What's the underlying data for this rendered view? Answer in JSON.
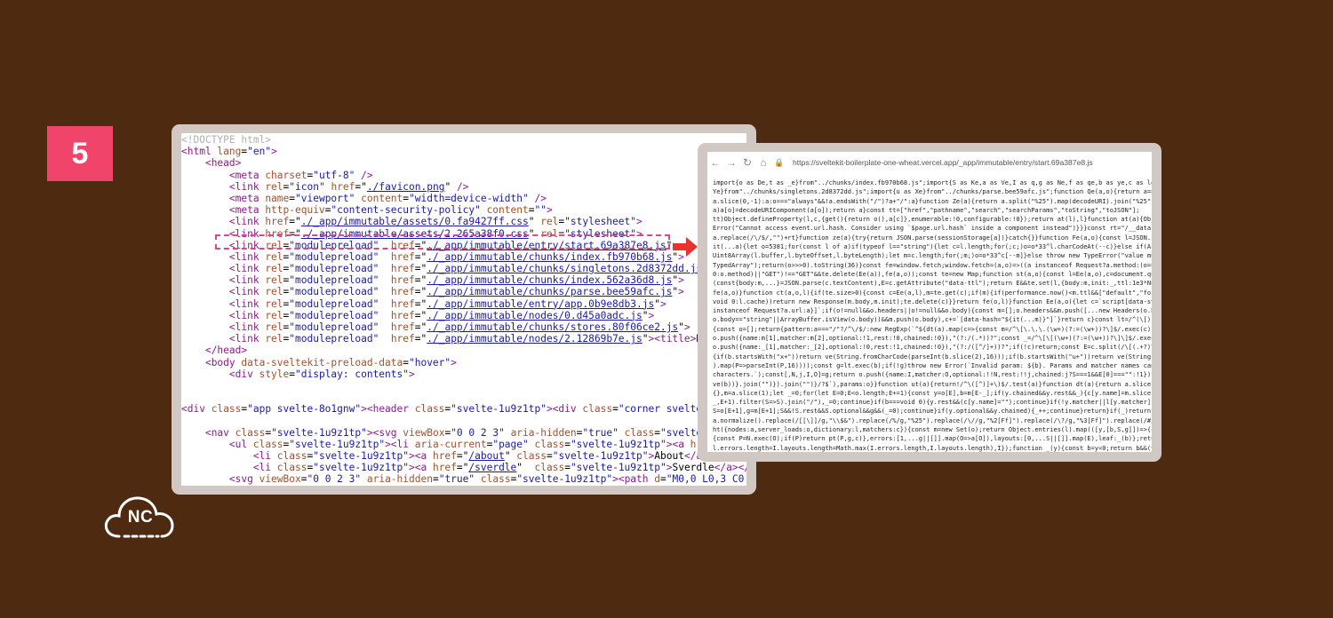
{
  "badge": "5",
  "logo_text": "NC",
  "source_lines": [
    [
      [
        "cm",
        "<!DOCTYPE html>"
      ]
    ],
    [
      [
        "tg",
        "<html "
      ],
      [
        "at",
        "lang"
      ],
      [
        "tx",
        "="
      ],
      [
        "av",
        "\"en\""
      ],
      [
        "tg",
        ">"
      ]
    ],
    [
      [
        "tx",
        "    "
      ],
      [
        "tg",
        "<head>"
      ]
    ],
    [
      [
        "tx",
        "        "
      ],
      [
        "tg",
        "<meta "
      ],
      [
        "at",
        "charset"
      ],
      [
        "tx",
        "="
      ],
      [
        "av",
        "\"utf-8\""
      ],
      [
        "tg",
        " />"
      ]
    ],
    [
      [
        "tx",
        "        "
      ],
      [
        "tg",
        "<link "
      ],
      [
        "at",
        "rel"
      ],
      [
        "tx",
        "="
      ],
      [
        "av",
        "\"icon\""
      ],
      [
        "tx",
        " "
      ],
      [
        "at",
        "href"
      ],
      [
        "tx",
        "=\""
      ],
      [
        "lk",
        "./favicon.png"
      ],
      [
        "tx",
        "\""
      ],
      [
        "tg",
        " />"
      ]
    ],
    [
      [
        "tx",
        "        "
      ],
      [
        "tg",
        "<meta "
      ],
      [
        "at",
        "name"
      ],
      [
        "tx",
        "="
      ],
      [
        "av",
        "\"viewport\""
      ],
      [
        "tx",
        " "
      ],
      [
        "at",
        "content"
      ],
      [
        "tx",
        "="
      ],
      [
        "av",
        "\"width=device-width\""
      ],
      [
        "tg",
        " />"
      ]
    ],
    [
      [
        "tx",
        "        "
      ],
      [
        "tg",
        "<meta "
      ],
      [
        "at",
        "http-equiv"
      ],
      [
        "tx",
        "="
      ],
      [
        "av",
        "\"content-security-policy\""
      ],
      [
        "tx",
        " "
      ],
      [
        "at",
        "content"
      ],
      [
        "tx",
        "="
      ],
      [
        "av",
        "\"\""
      ],
      [
        "tg",
        ">"
      ]
    ],
    [
      [
        "tx",
        "        "
      ],
      [
        "tg",
        "<link "
      ],
      [
        "at",
        "href"
      ],
      [
        "tx",
        "=\""
      ],
      [
        "lk",
        "./_app/immutable/assets/0.fa9427ff.css"
      ],
      [
        "tx",
        "\" "
      ],
      [
        "at",
        "rel"
      ],
      [
        "tx",
        "="
      ],
      [
        "av",
        "\"stylesheet\""
      ],
      [
        "tg",
        ">"
      ]
    ],
    [
      [
        "tx",
        "        "
      ],
      [
        "tg",
        "<link "
      ],
      [
        "at",
        "href"
      ],
      [
        "tx",
        "=\""
      ],
      [
        "lk",
        "./_app/immutable/assets/2.265a38f0.css"
      ],
      [
        "tx",
        "\" "
      ],
      [
        "at",
        "rel"
      ],
      [
        "tx",
        "="
      ],
      [
        "av",
        "\"stylesheet\""
      ],
      [
        "tg",
        ">"
      ]
    ],
    [
      [
        "tx",
        "        "
      ],
      [
        "tg",
        "<link "
      ],
      [
        "at",
        "rel"
      ],
      [
        "tx",
        "="
      ],
      [
        "av",
        "\"modulepreload\""
      ],
      [
        "tx",
        "  "
      ],
      [
        "at",
        "href"
      ],
      [
        "tx",
        "=\""
      ],
      [
        "lk",
        "./_app/immutable/entry/start.69a387e8.js"
      ],
      [
        "tx",
        "\""
      ],
      [
        "tg",
        ">"
      ]
    ],
    [
      [
        "tx",
        "        "
      ],
      [
        "tg",
        "<link "
      ],
      [
        "at",
        "rel"
      ],
      [
        "tx",
        "="
      ],
      [
        "av",
        "\"modulepreload\""
      ],
      [
        "tx",
        "  "
      ],
      [
        "at",
        "href"
      ],
      [
        "tx",
        "=\""
      ],
      [
        "lk",
        "./_app/immutable/chunks/index.fb970b68.js"
      ],
      [
        "tx",
        "\""
      ],
      [
        "tg",
        ">"
      ]
    ],
    [
      [
        "tx",
        "        "
      ],
      [
        "tg",
        "<link "
      ],
      [
        "at",
        "rel"
      ],
      [
        "tx",
        "="
      ],
      [
        "av",
        "\"modulepreload\""
      ],
      [
        "tx",
        "  "
      ],
      [
        "at",
        "href"
      ],
      [
        "tx",
        "=\""
      ],
      [
        "lk",
        "./_app/immutable/chunks/singletons.2d8372dd.js"
      ],
      [
        "tx",
        "\""
      ],
      [
        "tg",
        ">"
      ]
    ],
    [
      [
        "tx",
        "        "
      ],
      [
        "tg",
        "<link "
      ],
      [
        "at",
        "rel"
      ],
      [
        "tx",
        "="
      ],
      [
        "av",
        "\"modulepreload\""
      ],
      [
        "tx",
        "  "
      ],
      [
        "at",
        "href"
      ],
      [
        "tx",
        "=\""
      ],
      [
        "lk",
        "./_app/immutable/chunks/index.562a36d8.js"
      ],
      [
        "tx",
        "\""
      ],
      [
        "tg",
        ">"
      ]
    ],
    [
      [
        "tx",
        "        "
      ],
      [
        "tg",
        "<link "
      ],
      [
        "at",
        "rel"
      ],
      [
        "tx",
        "="
      ],
      [
        "av",
        "\"modulepreload\""
      ],
      [
        "tx",
        "  "
      ],
      [
        "at",
        "href"
      ],
      [
        "tx",
        "=\""
      ],
      [
        "lk",
        "./_app/immutable/chunks/parse.bee59afc.js"
      ],
      [
        "tx",
        "\""
      ],
      [
        "tg",
        ">"
      ]
    ],
    [
      [
        "tx",
        "        "
      ],
      [
        "tg",
        "<link "
      ],
      [
        "at",
        "rel"
      ],
      [
        "tx",
        "="
      ],
      [
        "av",
        "\"modulepreload\""
      ],
      [
        "tx",
        "  "
      ],
      [
        "at",
        "href"
      ],
      [
        "tx",
        "=\""
      ],
      [
        "lk",
        "./_app/immutable/entry/app.0b9e8db3.js"
      ],
      [
        "tx",
        "\""
      ],
      [
        "tg",
        ">"
      ]
    ],
    [
      [
        "tx",
        "        "
      ],
      [
        "tg",
        "<link "
      ],
      [
        "at",
        "rel"
      ],
      [
        "tx",
        "="
      ],
      [
        "av",
        "\"modulepreload\""
      ],
      [
        "tx",
        "  "
      ],
      [
        "at",
        "href"
      ],
      [
        "tx",
        "=\""
      ],
      [
        "lk",
        "./_app/immutable/nodes/0.d45a0adc.js"
      ],
      [
        "tx",
        "\""
      ],
      [
        "tg",
        ">"
      ]
    ],
    [
      [
        "tx",
        "        "
      ],
      [
        "tg",
        "<link "
      ],
      [
        "at",
        "rel"
      ],
      [
        "tx",
        "="
      ],
      [
        "av",
        "\"modulepreload\""
      ],
      [
        "tx",
        "  "
      ],
      [
        "at",
        "href"
      ],
      [
        "tx",
        "=\""
      ],
      [
        "lk",
        "./_app/immutable/chunks/stores.80f06ce2.js"
      ],
      [
        "tx",
        "\""
      ],
      [
        "tg",
        ">"
      ]
    ],
    [
      [
        "tx",
        "        "
      ],
      [
        "tg",
        "<link "
      ],
      [
        "at",
        "rel"
      ],
      [
        "tx",
        "="
      ],
      [
        "av",
        "\"modulepreload\""
      ],
      [
        "tx",
        "  "
      ],
      [
        "at",
        "href"
      ],
      [
        "tx",
        "=\""
      ],
      [
        "lk",
        "./_app/immutable/nodes/2.12869b7e.js"
      ],
      [
        "tx",
        "\""
      ],
      [
        "tg",
        "><title>"
      ],
      [
        "tx",
        "Home"
      ],
      [
        "tg",
        "</tit"
      ]
    ],
    [
      [
        "tx",
        "    "
      ],
      [
        "tg",
        "</head>"
      ]
    ],
    [
      [
        "tx",
        "    "
      ],
      [
        "tg",
        "<body "
      ],
      [
        "at",
        "data-sveltekit-preload-data"
      ],
      [
        "tx",
        "="
      ],
      [
        "av",
        "\"hover\""
      ],
      [
        "tg",
        ">"
      ]
    ],
    [
      [
        "tx",
        "        "
      ],
      [
        "tg",
        "<div "
      ],
      [
        "at",
        "style"
      ],
      [
        "tx",
        "="
      ],
      [
        "av",
        "\"display: contents\""
      ],
      [
        "tg",
        ">"
      ]
    ],
    [
      [
        "tx",
        ""
      ]
    ],
    [
      [
        "tx",
        ""
      ]
    ],
    [
      [
        "tg",
        "<div "
      ],
      [
        "at",
        "class"
      ],
      [
        "tx",
        "="
      ],
      [
        "av",
        "\"app svelte-8o1gnw\""
      ],
      [
        "tg",
        "><header "
      ],
      [
        "at",
        "class"
      ],
      [
        "tx",
        "="
      ],
      [
        "av",
        "\"svelte-1u9z1tp\""
      ],
      [
        "tg",
        "><div "
      ],
      [
        "at",
        "class"
      ],
      [
        "tx",
        "="
      ],
      [
        "av",
        "\"corner svelte-1u9z1"
      ]
    ],
    [
      [
        "tx",
        ""
      ]
    ],
    [
      [
        "tx",
        "    "
      ],
      [
        "tg",
        "<nav "
      ],
      [
        "at",
        "class"
      ],
      [
        "tx",
        "="
      ],
      [
        "av",
        "\"svelte-1u9z1tp\""
      ],
      [
        "tg",
        "><svg "
      ],
      [
        "at",
        "viewBox"
      ],
      [
        "tx",
        "="
      ],
      [
        "av",
        "\"0 0 2 3\""
      ],
      [
        "tx",
        " "
      ],
      [
        "at",
        "aria-hidden"
      ],
      [
        "tx",
        "="
      ],
      [
        "av",
        "\"true\""
      ],
      [
        "tx",
        " "
      ],
      [
        "at",
        "class"
      ],
      [
        "tx",
        "="
      ],
      [
        "av",
        "\"svelte-1u9z1t"
      ]
    ],
    [
      [
        "tx",
        "        "
      ],
      [
        "tg",
        "<ul "
      ],
      [
        "at",
        "class"
      ],
      [
        "tx",
        "="
      ],
      [
        "av",
        "\"svelte-1u9z1tp\""
      ],
      [
        "tg",
        "><li "
      ],
      [
        "at",
        "aria-current"
      ],
      [
        "tx",
        "="
      ],
      [
        "av",
        "\"page\""
      ],
      [
        "tx",
        " "
      ],
      [
        "at",
        "class"
      ],
      [
        "tx",
        "="
      ],
      [
        "av",
        "\"svelte-1u9z1tp\""
      ],
      [
        "tg",
        "><a "
      ],
      [
        "at",
        "href"
      ],
      [
        "tx",
        "=\""
      ],
      [
        "lk",
        "/"
      ]
    ],
    [
      [
        "tx",
        "            "
      ],
      [
        "tg",
        "<li "
      ],
      [
        "at",
        "class"
      ],
      [
        "tx",
        "="
      ],
      [
        "av",
        "\"svelte-1u9z1tp\""
      ],
      [
        "tg",
        "><a "
      ],
      [
        "at",
        "href"
      ],
      [
        "tx",
        "=\""
      ],
      [
        "lk",
        "/about"
      ],
      [
        "tx",
        "\" "
      ],
      [
        "at",
        "class"
      ],
      [
        "tx",
        "="
      ],
      [
        "av",
        "\"svelte-1u9z1tp\""
      ],
      [
        "tg",
        ">"
      ],
      [
        "tx",
        "About"
      ],
      [
        "tg",
        "</a></li"
      ]
    ],
    [
      [
        "tx",
        "            "
      ],
      [
        "tg",
        "<li "
      ],
      [
        "at",
        "class"
      ],
      [
        "tx",
        "="
      ],
      [
        "av",
        "\"svelte-1u9z1tp\""
      ],
      [
        "tg",
        "><a "
      ],
      [
        "at",
        "href"
      ],
      [
        "tx",
        "=\""
      ],
      [
        "lk",
        "/sverdle"
      ],
      [
        "tx",
        "\"  "
      ],
      [
        "at",
        "class"
      ],
      [
        "tx",
        "="
      ],
      [
        "av",
        "\"svelte-1u9z1tp\""
      ],
      [
        "tg",
        ">"
      ],
      [
        "tx",
        "Sverdle"
      ],
      [
        "tg",
        "</a></li></u"
      ]
    ],
    [
      [
        "tx",
        "        "
      ],
      [
        "tg",
        "<svg "
      ],
      [
        "at",
        "viewBox"
      ],
      [
        "tx",
        "="
      ],
      [
        "av",
        "\"0 0 2 3\""
      ],
      [
        "tx",
        " "
      ],
      [
        "at",
        "aria-hidden"
      ],
      [
        "tx",
        "="
      ],
      [
        "av",
        "\"true\""
      ],
      [
        "tx",
        " "
      ],
      [
        "at",
        "class"
      ],
      [
        "tx",
        "="
      ],
      [
        "av",
        "\"svelte-1u9z1tp\""
      ],
      [
        "tg",
        "><path "
      ],
      [
        "at",
        "d"
      ],
      [
        "tx",
        "="
      ],
      [
        "av",
        "\"M0,0 L0,3 C0.5,3 0"
      ]
    ]
  ],
  "browser": {
    "url": "https://sveltekit-boilerplate-one-wheat.vercel.app/_app/immutable/entry/start.69a387e8.js"
  },
  "js_dump": [
    "import{o as De,t as _e}from\"../chunks/index.fb970b68.js\";import{S as Ke,a as Ve,I as q,g as Ne,f as qe,b as ye,c as le,i",
    "Ye}from\"../chunks/singletons.2d8372dd.js\";import{u as Xe}from\"../chunks/parse.bee59afc.js\";function Qe(a,o){return a===",
    "a.slice(0,-1):a:o===\"always\"&&!a.endsWith(\"/\")?a+\"/\":a}function Ze(a){return a.split(\"%25\").map(decodeURI).join(\"%25\")}",
    "a)a[o]=decodeURIComponent(a[o]);return a}const tt=[\"href\",\"pathname\",\"search\",\"searchParams\",\"toString\",\"toJSON\"];",
    "tt)Object.defineProperty(l,c,{get(){return o(),a[c]},enumerable:!0,configurable:!0});return at(l),l}function at(a){Obje",
    "Error(\"Cannot access event.url.hash. Consider using `$page.url.hash` inside a component instead\")}}}const rt=\"/__data.",
    "a.replace(/\\/$/,\"\")+rt}function ze(a){try{return JSON.parse(sessionStorage[a])}catch{}}function Fe(a,o){const l=JSON.st",
    "it(...a){let o=5381;for(const l of a)if(typeof l==\"string\"){let c=l.length;for(;c;)o=o*33^l.charCodeAt(--c)}else if(Arr",
    "Uint8Array(l.buffer,l.byteOffset,l.byteLength);let m=c.length;for(;m;)o=o*33^c[--m]}else throw new TypeError(\"value mu",
    "TypedArray\");return(o>>>0).toString(36)}const fe=window.fetch;window.fetch=(a,o)=>((a instanceof Request?a.method:(o==n",
    "0:o.method)||\"GET\")!==\"GET\"&&te.delete(Ee(a)),fe(a,o));const te=new Map;function st(a,o){const l=Ee(a,o),c=document.que",
    "(const{body:m,...}=JSON.parse(c.textContent),E=c.getAttribute(\"data-ttl\");return E&&te.set(l,{body:m,init:_,ttl:1e3*Nu",
    "fe(a,o)}function ct(a,o,l){if(te.size>0){const c=Ee(a,l),m=te.get(c);if(m){if(performance.now()<m.ttl&&[\"default\",\"forc",
    "void 0:l.cache))return new Response(m.body,m.init);te.delete(c)}}return fe(o,l)}function Ee(a,o){let c=`script[data-sve",
    "instanceof Request?a.url:a}]`;if(o!=null&&o.headers||o!=null&&o.body){const m=[];o.headers&&m.push([...new Headers(o.h",
    "o.body==\"string\"||ArrayBuffer.isView(o.body))&&m.push(o.body),c+=`[data-hash=\"${it(...m)}\"]`}return c}const lt=/^(\\[)?(",
    "{const o=[];return{pattern:a===\"/\"?/^\\/$/:new RegExp(`^${dt(a).map(c=>{const m=/^\\[\\.\\.\\.(\\w+)(?:=(\\w+))?\\]$/.exec(c);i",
    "o.push({name:m[1],matcher:m[2],optional:!1,rest:!0,chained:!0}),\"(?:/(.*))?\";const _=/^\\[\\[(\\w+)(?:=(\\w+))?\\]\\]$/.exec(",
    "o.push({name:_[1],matcher:_[2],optional:!0,rest:!1,chained:!0}),\"(?:/([^/]+))?\";if(!c)return;const E=c.split(/\\[(.+?)\\",
    "{if(b.startsWith(\"x+\"))return ve(String.fromCharCode(parseInt(b.slice(2),16)));if(b.startsWith(\"u+\"))return ve(String.f",
    ").map(P=>parseInt(P,16))));const g=lt.exec(b);if(!g)throw new Error(`Invalid param: ${b}. Params and matcher names can",
    "characters.`);const[,N,j,I,O]=g;return o.push({name:I,matcher:O,optional:!!N,rest:!!j,chained:j?S===1&&E[0]===\"\":!1}),",
    "ve(b))}.join(\"\")}).join(\"\")}/?$`),params:o}}function ut(a){return!/^\\([^)]+\\)$/.test(a)}function dt(a){return a.slice(1",
    "{},m=a.slice(1);let _=0;for(let E=0;E<o.length;E+=1){const y=o[E],b=m[E-_];if(y.chained&&y.rest&&_){c[y.name]=m.slice(E",
    "_,E+1).filter(S=>S).join(\"/\"),_=0;continue}if(b===void 0){y.rest&&(c[y.name]=\"\");continue}if(!y.matcher||l[y.matcher](",
    "S=o[E+1],g=m[E+1];S&&!S.rest&&S.optional&&g&&(_=0);continue}if(y.optional&&y.chained){_++;continue}return}if(_)return",
    "a.normalize().replace(/[[\\]]/g,\"\\\\$&\").replace(/%/g,\"%25\").replace(/\\//g,\"%2[Ff]\").replace(/\\?/g,\"%3[Ff]\").replace(/#/g",
    "ht({nodes:a,server_loads:o,dictionary:l,matchers:c}){const m=new Set(o);return Object.entries(l).map(([y,[b,S,g]])=>{co",
    "{const P=N.exec(O);if(P)return pt(P,g,c)},errors:[1,...g||[]].map(O=>a[O]),layouts:[0,...S||[]].map(E),leaf:_(b)};retur",
    "l.errors.length=I.layouts.length=Math.max(I.errors.length,I.layouts.length),I});function _(y){const b=y<0;return b&&(y=",
    "[m.has(y),a[y]]}}let ee=class{constructor(o,l){this.status=o,typeof l==\"string\"?this.body={message:l}:l?this.body=l:th",
    "JSON.stringify(this.body)}},He=class{constructor(o,l){this.status=o,this.location=l}};async function mt(a){var o;for(co",
    "o.then)==\"function\")return Object.fromEntries(await Promise.all(Object.entries(a).map(async([c,m])=>[c,await m])));retur",
    "Set([\"load\",\"prerender\",\"csr\",\"ssr\",\"trailingSlash\",\"config\"]);[...Be];const gt=new Set([...Be,\"actions\"]);[...gt];func",
    "sveltekit-invalidated\",z=ze(Ke)??{},Q=ze(Ve)??{};function be(a){z[a]=Z()}function wt(a,o){var Ie;const l=ht(a),c=a.node"
  ]
}
